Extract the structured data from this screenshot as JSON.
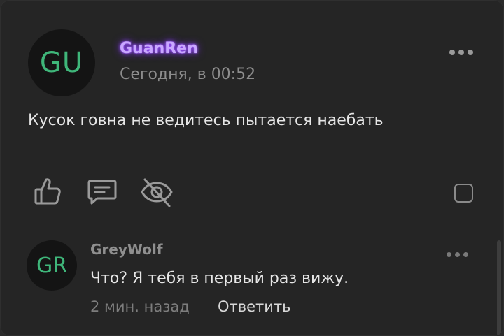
{
  "post": {
    "avatar_initials": "GU",
    "author": "GuanRen",
    "timestamp": "Сегодня, в 00:52",
    "text": "Кусок говна не ведитесь пытается наебать",
    "actions": {
      "like_icon": "thumbs-up-icon",
      "comment_icon": "comment-icon",
      "hide_icon": "eye-off-icon"
    }
  },
  "reply": {
    "avatar_initials": "GR",
    "author": "GreyWolf",
    "text": "Что? Я тебя в первый раз вижу.",
    "time": "2 мин. назад",
    "reply_label": "Ответить"
  },
  "colors": {
    "background": "#252525",
    "avatar_text": "#3fb67a",
    "author_glow": "#9b51ff"
  }
}
